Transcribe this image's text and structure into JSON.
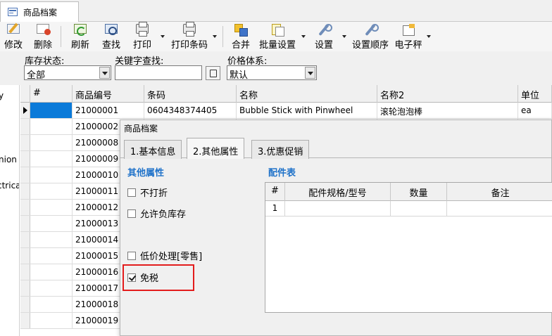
{
  "window_tab": {
    "title": "商品档案",
    "icon": "form-window-icon"
  },
  "toolbar": {
    "buttons": [
      {
        "label": "修改",
        "icon": "edit-icon"
      },
      {
        "label": "删除",
        "icon": "delete-icon"
      },
      {
        "label": "刷新",
        "icon": "refresh-icon"
      },
      {
        "label": "查找",
        "icon": "find-icon"
      },
      {
        "label": "打印",
        "icon": "printer-icon"
      },
      {
        "label": "打印条码",
        "icon": "printer-icon"
      },
      {
        "label": "合并",
        "icon": "merge-icon"
      },
      {
        "label": "批量设置",
        "icon": "batch-settings-icon"
      },
      {
        "label": "设置",
        "icon": "wrench-icon"
      },
      {
        "label": "设置顺序",
        "icon": "wrench-icon"
      },
      {
        "label": "电子秤",
        "icon": "scale-icon"
      }
    ]
  },
  "filters": {
    "stock_status": {
      "label": "库存状态:",
      "value": "全部"
    },
    "keyword": {
      "label": "关键字查找:",
      "value": ""
    },
    "price_system": {
      "label": "价格体系:",
      "value": "默认"
    }
  },
  "left_panel": {
    "fragments": [
      "y",
      "nion",
      "ctrica"
    ]
  },
  "grid": {
    "columns": [
      "#",
      "商品编号",
      "条码",
      "名称",
      "名称2",
      "单位"
    ],
    "rows": [
      {
        "code": "21000001",
        "barcode": "0604348374405",
        "name": "Bubble Stick with Pinwheel",
        "name2": "滚轮泡泡棒",
        "unit": "ea"
      },
      {
        "code": "21000002"
      },
      {
        "code": "21000008"
      },
      {
        "code": "21000009"
      },
      {
        "code": "21000010"
      },
      {
        "code": "21000011"
      },
      {
        "code": "21000012"
      },
      {
        "code": "21000013"
      },
      {
        "code": "21000014"
      },
      {
        "code": "21000015"
      },
      {
        "code": "21000016"
      },
      {
        "code": "21000017"
      },
      {
        "code": "21000018"
      },
      {
        "code": "21000019"
      }
    ]
  },
  "dialog": {
    "title": "商品档案",
    "tabs": [
      "1.基本信息",
      "2.其他属性",
      "3.优惠促销"
    ],
    "active_tab": "2.其他属性",
    "other_props": {
      "title": "其他属性",
      "checkboxes": [
        {
          "label": "不打折",
          "checked": false
        },
        {
          "label": "允许负库存",
          "checked": false
        },
        {
          "label": "低价处理[零售]",
          "checked": false
        },
        {
          "label": "免税",
          "checked": true
        }
      ]
    },
    "parts": {
      "title": "配件表",
      "columns": [
        "#",
        "配件规格/型号",
        "数量",
        "备注"
      ],
      "rows": [
        {
          "num": "1",
          "spec": "",
          "qty": "",
          "note": ""
        }
      ]
    }
  },
  "colors": {
    "accent_blue": "#1f72c9",
    "selection": "#0a7ad9",
    "highlight_red": "#e31c1c"
  }
}
